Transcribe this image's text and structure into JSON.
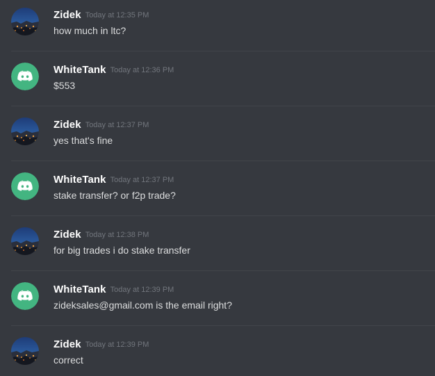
{
  "messages": [
    {
      "author": "Zidek",
      "avatar": "zidek-city-avatar",
      "time": "Today at 12:35 PM",
      "text": "how much in ltc?"
    },
    {
      "author": "WhiteTank",
      "avatar": "discord-logo-avatar",
      "time": "Today at 12:36 PM",
      "text": "$553"
    },
    {
      "author": "Zidek",
      "avatar": "zidek-city-avatar",
      "time": "Today at 12:37 PM",
      "text": "yes that's fine"
    },
    {
      "author": "WhiteTank",
      "avatar": "discord-logo-avatar",
      "time": "Today at 12:37 PM",
      "text": "stake transfer? or f2p trade?"
    },
    {
      "author": "Zidek",
      "avatar": "zidek-city-avatar",
      "time": "Today at 12:38 PM",
      "text": "for big trades i do stake transfer"
    },
    {
      "author": "WhiteTank",
      "avatar": "discord-logo-avatar",
      "time": "Today at 12:39 PM",
      "text": "zideksales@gmail.com is the email right?"
    },
    {
      "author": "Zidek",
      "avatar": "zidek-city-avatar",
      "time": "Today at 12:39 PM",
      "text": "correct"
    }
  ],
  "colors": {
    "background": "#36393f",
    "divider": "#42454a",
    "username": "#ffffff",
    "timestamp": "#72767d",
    "message_text": "#dcddde",
    "discord_avatar_bg": "#43b581"
  }
}
